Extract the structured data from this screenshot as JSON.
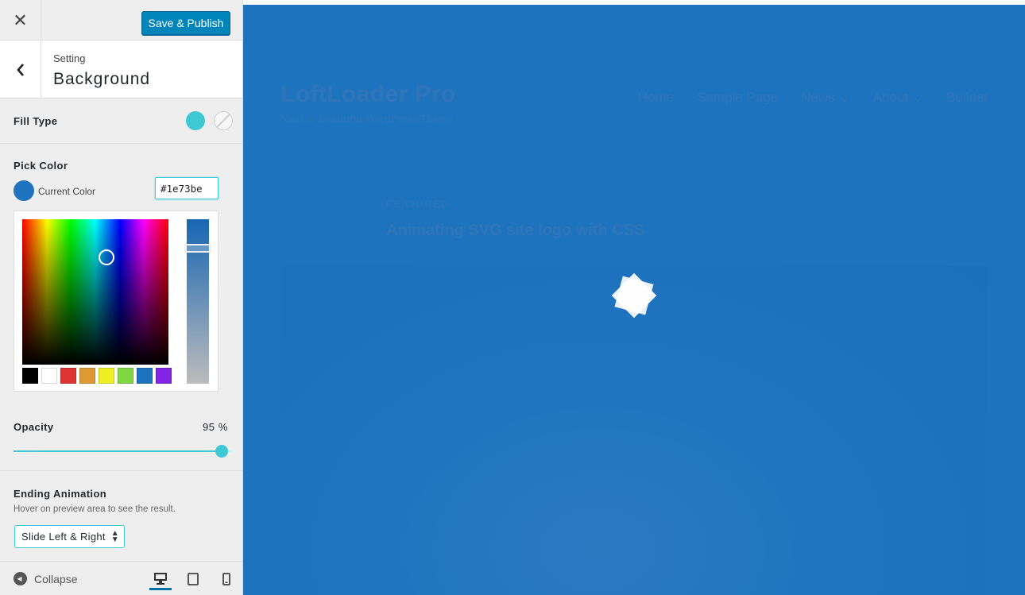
{
  "topbar": {
    "close_glyph": "✕",
    "publish_label": "Save & Publish"
  },
  "section": {
    "back_glyph": "‹",
    "kicker": "Setting",
    "title": "Background"
  },
  "fill_type": {
    "label": "Fill Type",
    "options": [
      "solid-color",
      "none"
    ],
    "selected": "solid-color",
    "solid_color": "#3ec9d6"
  },
  "pick_color": {
    "label": "Pick Color",
    "current_label": "Current Color",
    "hex_value": "#1e73be",
    "swatch_color": "#1e73be",
    "palette": [
      "#000000",
      "#ffffff",
      "#dd3333",
      "#dd9933",
      "#eeee22",
      "#81d742",
      "#1e73be",
      "#8224e3"
    ]
  },
  "opacity": {
    "label": "Opacity",
    "value_text": "95 %",
    "value": 95,
    "accent": "#3ec9d6"
  },
  "ending_animation": {
    "label": "Ending Animation",
    "hint": "Hover on preview area to see the result.",
    "selected": "Slide Left & Right"
  },
  "footer": {
    "collapse_label": "Collapse",
    "devices": [
      "desktop",
      "tablet",
      "mobile"
    ],
    "active_device": "desktop"
  },
  "preview": {
    "overlay_color": "#1e73be",
    "site_title": "LoftLoader Pro",
    "site_tagline": "Neat & Beautiful WordPress Theme",
    "nav": [
      "Home",
      "Sample Page",
      "News ⌄",
      "About ⌄",
      "Builder"
    ],
    "featured_kicker": "FEATURED",
    "featured_title": "Animating SVG site logo with CSS"
  }
}
